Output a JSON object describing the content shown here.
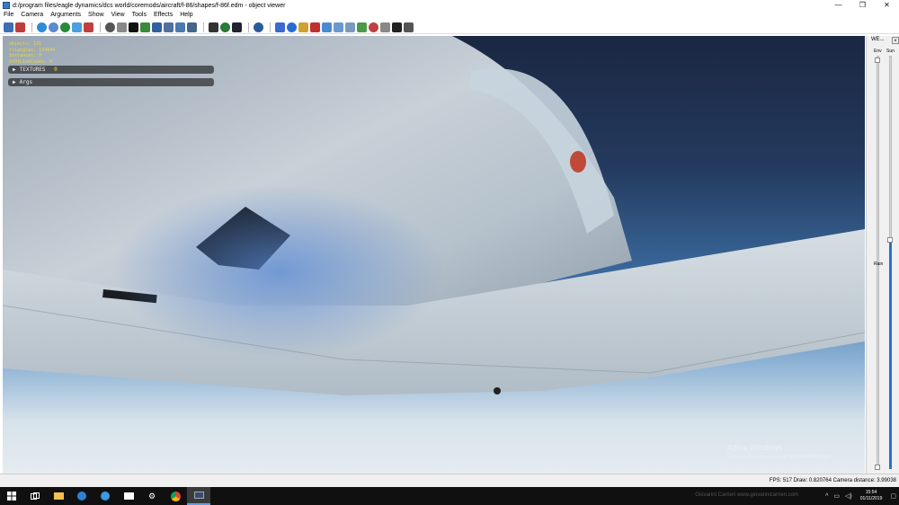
{
  "window": {
    "title": "d:/program files/eagle dynamics/dcs world/coremods/aircraft/f-86/shapes/f-86f.edm - object viewer",
    "controls": [
      "—",
      "❐",
      "✕"
    ]
  },
  "menu": [
    "File",
    "Camera",
    "Arguments",
    "Show",
    "View",
    "Tools",
    "Effects",
    "Help"
  ],
  "hud": {
    "lines": [
      "objects: 121",
      "triangles: 134944",
      "instances: 0",
      "drDtLinkCodes: 0"
    ],
    "textures_label": "TEXTURES",
    "textures_count": "0",
    "args_label": "Args"
  },
  "weather_panel": {
    "title": "WE...",
    "close": "×",
    "env_label": "Env",
    "sun_label": "Sun",
    "rain_label": "Rain",
    "rain_level": 0.54
  },
  "watermark": {
    "title": "Attiva Windows",
    "subtitle": "Passa a Impostazioni per attivare Windows."
  },
  "status": {
    "text": "FPS: 517  Draw: 0.820764  Camera distance: 3.99038"
  },
  "taskbar": {
    "apps": [
      "start-icon",
      "task-view-icon",
      "file-explorer-icon",
      "edge-icon",
      "internet-explorer-icon",
      "mail-icon",
      "settings-icon",
      "chrome-icon",
      "object-viewer-icon"
    ],
    "faint_text": "Giovanni Carrieri www.giovannicarrieri.com",
    "time": "15:54",
    "date": "01/11/2019"
  }
}
